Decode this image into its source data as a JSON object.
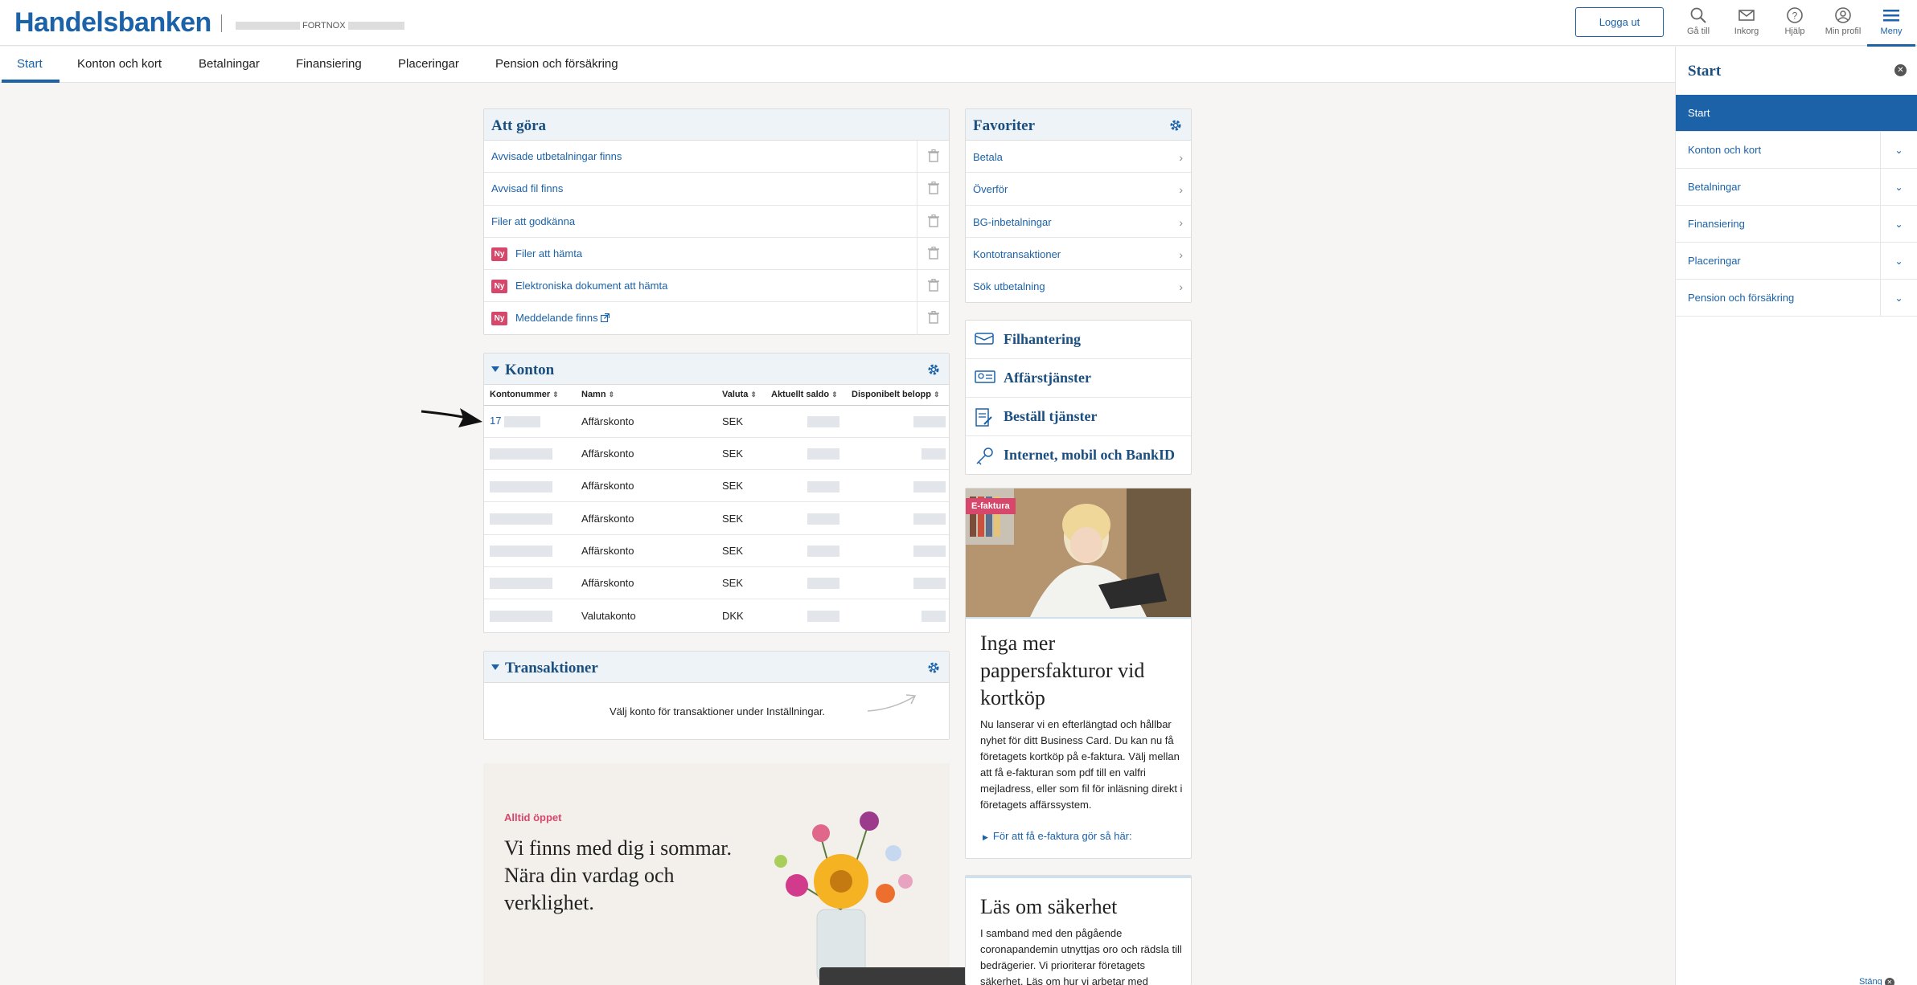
{
  "header": {
    "brand": "Handelsbanken",
    "company_name": "FORTNOX",
    "logout_label": "Logga ut",
    "tools": [
      {
        "label": "Gå till",
        "icon": "search-icon"
      },
      {
        "label": "Inkorg",
        "icon": "mail-icon"
      },
      {
        "label": "Hjälp",
        "icon": "help-icon"
      },
      {
        "label": "Min profil",
        "icon": "profile-icon"
      },
      {
        "label": "Meny",
        "icon": "menu-icon"
      }
    ]
  },
  "nav": {
    "tabs": [
      "Start",
      "Konton och kort",
      "Betalningar",
      "Finansiering",
      "Placeringar",
      "Pension och försäkring"
    ],
    "active": "Start"
  },
  "todo": {
    "title": "Att göra",
    "items": [
      {
        "label": "Avvisade utbetalningar finns",
        "new": false
      },
      {
        "label": "Avvisad fil finns",
        "new": false
      },
      {
        "label": "Filer att godkänna",
        "new": false
      },
      {
        "label": "Filer att hämta",
        "new": true
      },
      {
        "label": "Elektroniska dokument att hämta",
        "new": true
      },
      {
        "label": "Meddelande finns",
        "new": true
      }
    ],
    "new_badge": "Ny"
  },
  "accounts": {
    "title": "Konton",
    "columns": [
      "Kontonummer",
      "Namn",
      "Valuta",
      "Aktuellt saldo",
      "Disponibelt belopp"
    ],
    "rows": [
      {
        "number": "17",
        "name": "Affärskonto",
        "currency": "SEK"
      },
      {
        "number": "",
        "name": "Affärskonto",
        "currency": "SEK"
      },
      {
        "number": "",
        "name": "Affärskonto",
        "currency": "SEK"
      },
      {
        "number": "",
        "name": "Affärskonto",
        "currency": "SEK"
      },
      {
        "number": "",
        "name": "Affärskonto",
        "currency": "SEK"
      },
      {
        "number": "",
        "name": "Affärskonto",
        "currency": "SEK"
      },
      {
        "number": "",
        "name": "Valutakonto",
        "currency": "DKK"
      }
    ]
  },
  "transactions": {
    "title": "Transaktioner",
    "hint": "Välj konto för transaktioner under Inställningar."
  },
  "favorites": {
    "title": "Favoriter",
    "items": [
      "Betala",
      "Överför",
      "BG-inbetalningar",
      "Kontotransaktioner",
      "Sök utbetalning"
    ]
  },
  "services": {
    "items": [
      {
        "label": "Filhantering",
        "icon": "file-tray-icon"
      },
      {
        "label": "Affärstjänster",
        "icon": "business-card-icon"
      },
      {
        "label": "Beställ tjänster",
        "icon": "order-document-icon"
      },
      {
        "label": "Internet, mobil och BankID",
        "icon": "key-icon"
      }
    ]
  },
  "efaktura": {
    "badge": "E-faktura",
    "title": "Inga mer pappersfakturor vid kortköp",
    "text": "Nu lanserar vi en efterlängtad och hållbar nyhet för ditt Business Card. Du kan nu få företagets kortköp på e-faktura. Välj mellan att få e-fakturan som pdf till en valfri mejladress, eller som fil för inläsning direkt i företagets affärssystem.",
    "link": "För att få e-faktura gör så här:"
  },
  "security": {
    "title": "Läs om säkerhet",
    "text": "I samband med den pågående coronapandemin utnyttjas oro och rädsla till bedrägerier. Vi prioriterar företagets säkerhet. Läs om hur vi arbetar med"
  },
  "promo": {
    "kicker": "Alltid öppet",
    "title": "Vi finns med dig i sommar. Nära din vardag och verklighet."
  },
  "sidemenu": {
    "title": "Start",
    "items": [
      "Start",
      "Konton och kort",
      "Betalningar",
      "Finansiering",
      "Placeringar",
      "Pension och försäkring"
    ],
    "active": "Start",
    "close_label": "Stäng"
  },
  "colors": {
    "brand": "#1b62a8",
    "badge": "#d6476b",
    "heading": "#1b4f80"
  }
}
